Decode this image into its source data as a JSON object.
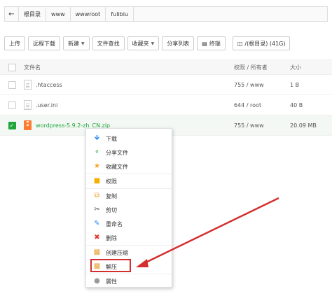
{
  "address": {
    "back_icon": "arrow-left-icon",
    "crumbs": [
      "根目录",
      "www",
      "wwwroot",
      "fulibiu"
    ]
  },
  "toolbar": {
    "upload": "上传",
    "remote_download": "远程下载",
    "new": "新建",
    "file_search": "文件查找",
    "favorites": "收藏夹",
    "share_list": "分享列表",
    "terminal": "终端",
    "disk": "/(根目录) (41G)"
  },
  "table": {
    "headers": {
      "name": "文件名",
      "perm": "权限 / 所有者",
      "size": "大小"
    },
    "rows": [
      {
        "name": ".htaccess",
        "perm": "755 / www",
        "size": "1 B",
        "checked": false
      },
      {
        "name": ".user.ini",
        "perm": "644 / root",
        "size": "40 B",
        "checked": false
      },
      {
        "name": "wordpress-5.9.2-zh_CN.zip",
        "perm": "755 / www",
        "size": "20.09 MB",
        "checked": true
      }
    ]
  },
  "context_menu": {
    "download": "下载",
    "share": "分享文件",
    "favorite": "收藏文件",
    "permission": "权限",
    "copy": "复制",
    "cut": "剪切",
    "rename": "重命名",
    "delete": "删除",
    "compress": "创建压缩",
    "extract": "解压",
    "properties": "属性"
  },
  "colors": {
    "accent_green": "#20a53a",
    "annotation_red": "#d32f2f"
  }
}
